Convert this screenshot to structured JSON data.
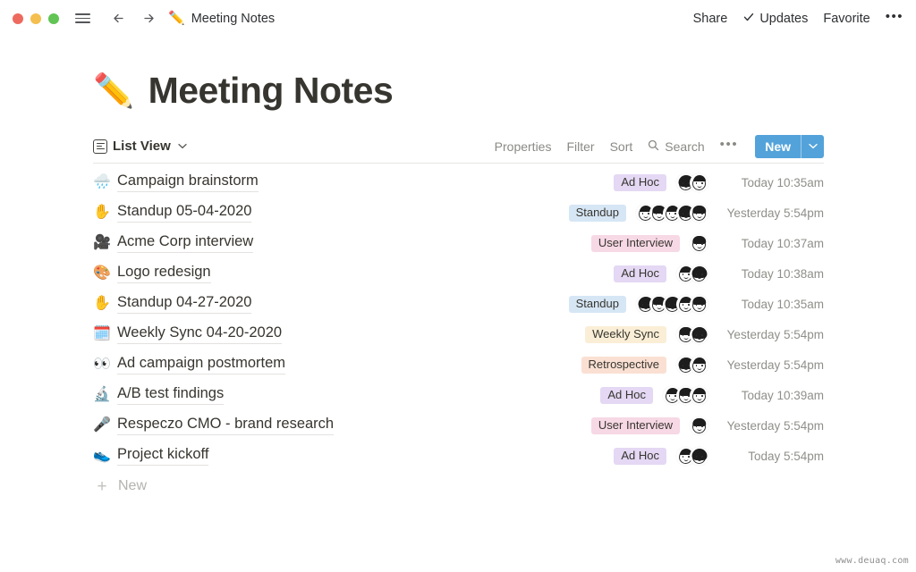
{
  "titlebar": {
    "window_controls": [
      "close",
      "minimize",
      "maximize"
    ],
    "menu_icon": "hamburger-icon",
    "back_label": "←",
    "forward_label": "→",
    "doc_emoji": "✏️",
    "doc_title": "Meeting Notes",
    "share_label": "Share",
    "updates_check": "✓",
    "updates_label": "Updates",
    "favorite_label": "Favorite",
    "more_label": "•••"
  },
  "page": {
    "emoji": "✏️",
    "title": "Meeting Notes"
  },
  "toolbar": {
    "view_label": "List View",
    "view_chevron": "⌄",
    "properties_label": "Properties",
    "filter_label": "Filter",
    "sort_label": "Sort",
    "search_label": "Search",
    "more_label": "•••",
    "new_label": "New",
    "new_chevron": "⌄",
    "new_button_color": "#53a3da"
  },
  "tag_colors": {
    "Ad Hoc": "#e4d8f4",
    "Standup": "#d6e6f5",
    "User Interview": "#f7d8e5",
    "Weekly Sync": "#faeed6",
    "Retrospective": "#fae0d3"
  },
  "list": {
    "rows": [
      {
        "emoji": "🌧️",
        "title": "Campaign brainstorm",
        "tag": "Ad Hoc",
        "avatars": 2,
        "date": "Today 10:35am"
      },
      {
        "emoji": "✋",
        "title": "Standup 05-04-2020",
        "tag": "Standup",
        "avatars": 5,
        "date": "Yesterday 5:54pm"
      },
      {
        "emoji": "🎥",
        "title": "Acme Corp interview",
        "tag": "User Interview",
        "avatars": 1,
        "date": "Today 10:37am"
      },
      {
        "emoji": "🎨",
        "title": "Logo redesign",
        "tag": "Ad Hoc",
        "avatars": 2,
        "date": "Today 10:38am"
      },
      {
        "emoji": "✋",
        "title": "Standup 04-27-2020",
        "tag": "Standup",
        "avatars": 5,
        "date": "Today 10:35am"
      },
      {
        "emoji": "🗓️",
        "title": "Weekly Sync 04-20-2020",
        "tag": "Weekly Sync",
        "avatars": 2,
        "date": "Yesterday 5:54pm"
      },
      {
        "emoji": "👀",
        "title": "Ad campaign postmortem",
        "tag": "Retrospective",
        "avatars": 2,
        "date": "Yesterday 5:54pm"
      },
      {
        "emoji": "🔬",
        "title": "A/B test findings",
        "tag": "Ad Hoc",
        "avatars": 3,
        "date": "Today 10:39am"
      },
      {
        "emoji": "🎤",
        "title": "Respeczo CMO - brand research",
        "tag": "User Interview",
        "avatars": 1,
        "date": "Yesterday 5:54pm"
      },
      {
        "emoji": "👟",
        "title": "Project kickoff",
        "tag": "Ad Hoc",
        "avatars": 2,
        "date": "Today 5:54pm"
      }
    ],
    "new_row_label": "New",
    "new_row_plus": "+"
  },
  "watermark": "www.deuaq.com"
}
